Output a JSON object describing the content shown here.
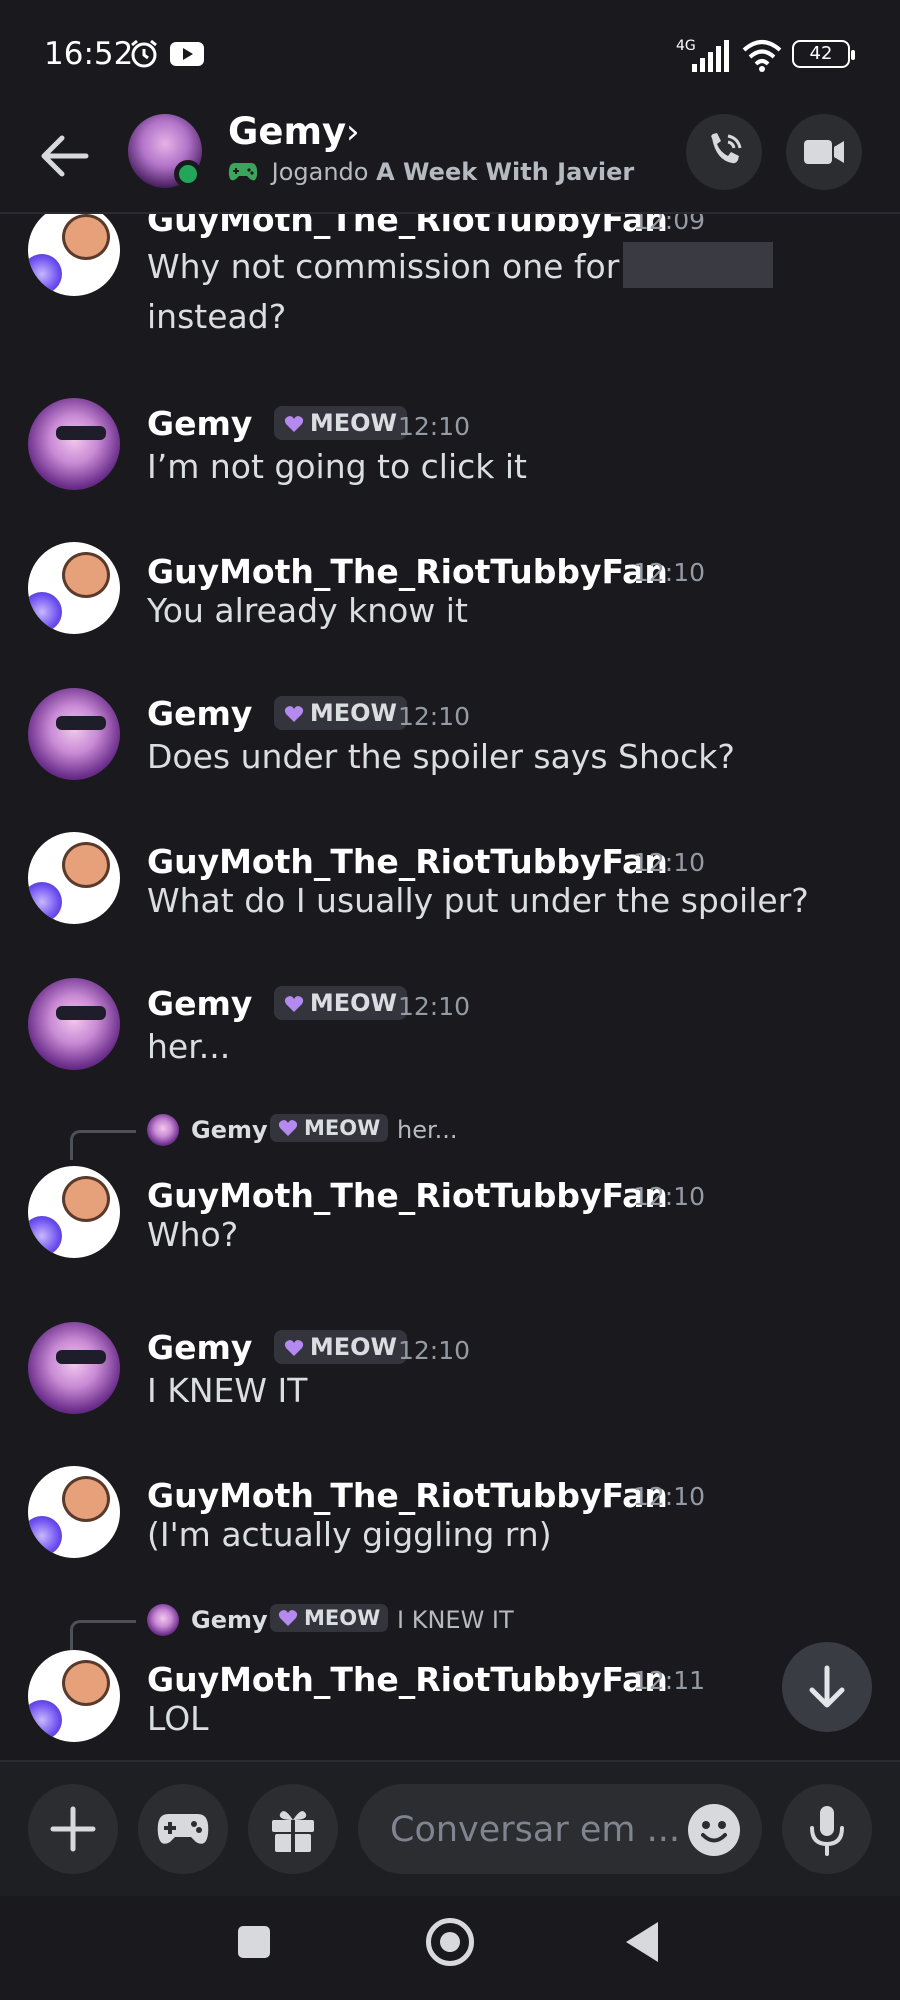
{
  "status_bar": {
    "time": "16:52",
    "network": "4G",
    "battery": "42"
  },
  "header": {
    "contact_name": "Gemy",
    "activity_prefix": "Jogando",
    "activity_game": "A Week With Javier"
  },
  "messages": [
    {
      "author": "GuyMoth_The_RiotTubbyFan",
      "time": "12:09",
      "text": "Why not commission one for",
      "text_line2": "instead?",
      "has_spoiler": true
    },
    {
      "author": "Gemy",
      "badge": "MEOW",
      "time": "12:10",
      "text": "I’m not going to click it"
    },
    {
      "author": "GuyMoth_The_RiotTubbyFan",
      "time": "12:10",
      "text": "You already know it"
    },
    {
      "author": "Gemy",
      "badge": "MEOW",
      "time": "12:10",
      "text": "Does under the spoiler says Shock?"
    },
    {
      "author": "GuyMoth_The_RiotTubbyFan",
      "time": "12:10",
      "text": "What do I usually put under the spoiler?"
    },
    {
      "author": "Gemy",
      "badge": "MEOW",
      "time": "12:10",
      "text": "her..."
    },
    {
      "reply_to": {
        "author": "Gemy",
        "badge": "MEOW",
        "text": "her..."
      },
      "author": "GuyMoth_The_RiotTubbyFan",
      "time": "12:10",
      "text": "Who?"
    },
    {
      "author": "Gemy",
      "badge": "MEOW",
      "time": "12:10",
      "text": "I KNEW IT"
    },
    {
      "author": "GuyMoth_The_RiotTubbyFan",
      "time": "12:10",
      "text": "(I'm actually giggling rn)"
    },
    {
      "reply_to": {
        "author": "Gemy",
        "badge": "MEOW",
        "text": "I KNEW IT"
      },
      "author": "GuyMoth_The_RiotTubbyFan",
      "time": "12:11",
      "text": "LOL"
    }
  ],
  "composer": {
    "placeholder": "Conversar em ..."
  },
  "icons": {
    "back": "arrow-left-icon",
    "call": "phone-icon",
    "video": "video-camera-icon",
    "add": "plus-icon",
    "games": "gamepad-icon",
    "gift": "gift-icon",
    "emoji": "emoji-icon",
    "mic": "microphone-icon",
    "jump": "arrow-down-icon"
  },
  "colors": {
    "background": "#1a1a1e",
    "online": "#23a55a",
    "badge_heart": "#b58af0",
    "game_icon": "#3ba55c"
  }
}
